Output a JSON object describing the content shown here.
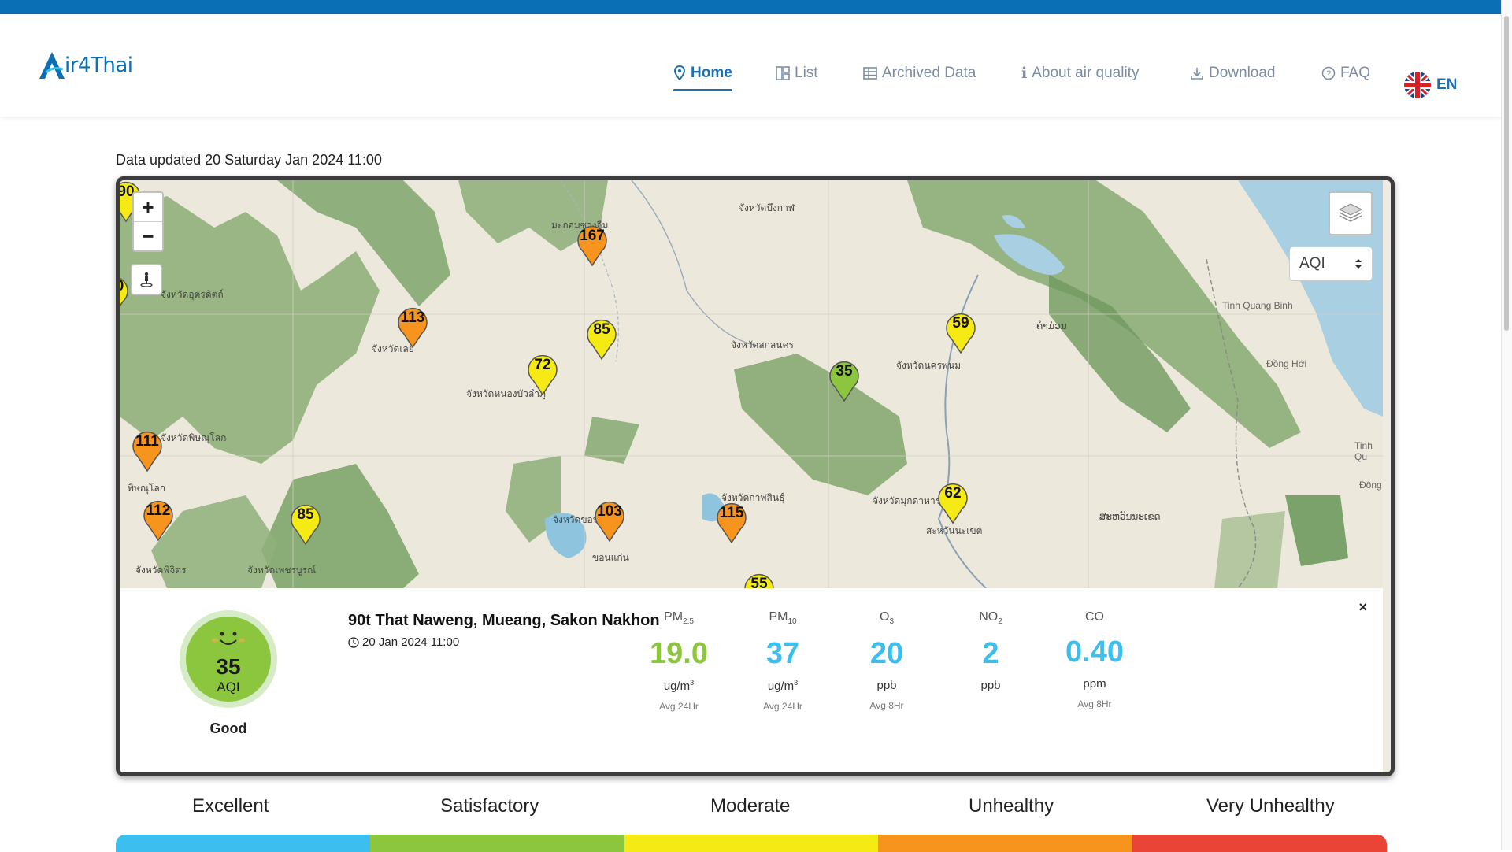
{
  "colors": {
    "brand": "#0a6fb5",
    "nav_active": "#1d6fb3",
    "nav_inactive": "#7c8da3",
    "good": "#8cc63f",
    "pm": "#8cc63f",
    "value_blue": "#3cbfee"
  },
  "header": {
    "logo_text": "ir4Thai",
    "nav": [
      {
        "label": "Home",
        "icon": "map-pin-icon",
        "active": true
      },
      {
        "label": "List",
        "icon": "list-icon"
      },
      {
        "label": "Archived Data",
        "icon": "table-icon"
      },
      {
        "label": "About air quality",
        "icon": "info-icon"
      },
      {
        "label": "Download",
        "icon": "download-icon"
      },
      {
        "label": "FAQ",
        "icon": "question-icon"
      }
    ],
    "language": "EN"
  },
  "updated_text": "Data updated 20 Saturday Jan 2024 11:00",
  "map": {
    "zoom_in": "+",
    "zoom_out": "−",
    "param_select": "AQI",
    "markers": [
      {
        "value": "167",
        "color": "#f7941d"
      },
      {
        "value": "113",
        "color": "#f7941d"
      },
      {
        "value": "85",
        "color": "#f5ea14"
      },
      {
        "value": "72",
        "color": "#f5ea14"
      },
      {
        "value": "59",
        "color": "#f5ea14"
      },
      {
        "value": "35",
        "color": "#8cc63f"
      },
      {
        "value": "111",
        "color": "#f7941d"
      },
      {
        "value": "112",
        "color": "#f7941d"
      },
      {
        "value": "85",
        "color": "#f5ea14"
      },
      {
        "value": "103",
        "color": "#f7941d"
      },
      {
        "value": "115",
        "color": "#f7941d"
      },
      {
        "value": "62",
        "color": "#f5ea14"
      },
      {
        "value": "90",
        "color": "#f5ea14"
      },
      {
        "value": "0",
        "color": "#f5ea14"
      },
      {
        "value": "55",
        "color": "#f5ea14"
      }
    ],
    "place_labels": [
      "จังหวัดบึงกาฬ",
      "มะถอมซวงจีม",
      "จังหวัดอุตรดิตถ์",
      "จังหวัดเลย",
      "จังหวัดสกลนคร",
      "จังหวัดนครพนม",
      "ຄໍາມ່ວນ",
      "Tinh Quang Binh",
      "Đồng Hới",
      "จังหวัดหนองบัวลำภู",
      "จังหวัดพิษณุโลก",
      "พิษณุโลก",
      "จังหวัดกาฬสินธุ์",
      "จังหวัดมุกดาหาร",
      "สะหวันนะเขต",
      "ສະຫວັນນະເຂດ",
      "Tinh Qu",
      "Đông",
      "จังหวัดพิจิตร",
      "จังหวัดเพชรบูรณ์",
      "ขอนแก่น",
      "จังหวัดขอนแก่น"
    ]
  },
  "panel": {
    "aqi_value": "35",
    "aqi_label": "AQI",
    "aqi_status": "Good",
    "station_name": "90t That Naweng, Mueang, Sakon Nakhon",
    "station_date": "20 Jan 2024 11:00",
    "close": "×",
    "pollutants": [
      {
        "name": "PM",
        "sub": "2.5",
        "value": "19.0",
        "unit": "ug/m",
        "sup": "3",
        "avg": "Avg 24Hr",
        "color": "#8cc63f"
      },
      {
        "name": "PM",
        "sub": "10",
        "value": "37",
        "unit": "ug/m",
        "sup": "3",
        "avg": "Avg 24Hr",
        "color": "#3cbfee"
      },
      {
        "name": "O",
        "sub": "3",
        "value": "20",
        "unit": "ppb",
        "sup": "",
        "avg": "Avg 8Hr",
        "color": "#3cbfee"
      },
      {
        "name": "NO",
        "sub": "2",
        "value": "2",
        "unit": "ppb",
        "sup": "",
        "avg": "",
        "color": "#3cbfee"
      },
      {
        "name": "CO",
        "sub": "",
        "value": "0.40",
        "unit": "ppm",
        "sup": "",
        "avg": "Avg 8Hr",
        "color": "#3cbfee"
      }
    ]
  },
  "legend": [
    {
      "label": "Excellent",
      "color": "#3cbfee"
    },
    {
      "label": "Satisfactory",
      "color": "#8cc63f"
    },
    {
      "label": "Moderate",
      "color": "#f5ea14"
    },
    {
      "label": "Unhealthy",
      "color": "#f7941d"
    },
    {
      "label": "Very Unhealthy",
      "color": "#e94435"
    }
  ]
}
